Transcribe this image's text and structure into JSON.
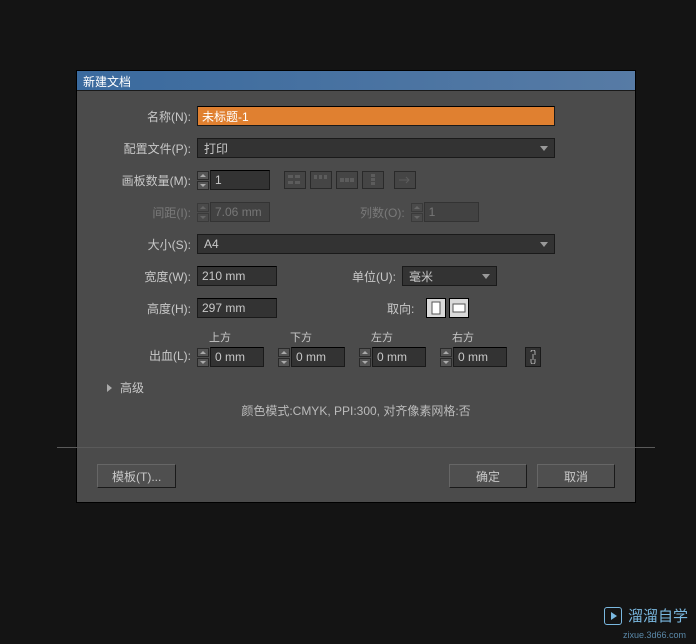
{
  "dialog": {
    "title": "新建文档",
    "name": {
      "label": "名称(N):",
      "value": "未标题-1"
    },
    "profile": {
      "label": "配置文件(P):",
      "value": "打印"
    },
    "artboards": {
      "label": "画板数量(M):",
      "value": "1"
    },
    "spacing": {
      "label": "间距(I):",
      "value": "7.06 mm"
    },
    "columns": {
      "label": "列数(O):",
      "value": "1"
    },
    "size": {
      "label": "大小(S):",
      "value": "A4"
    },
    "width": {
      "label": "宽度(W):",
      "value": "210 mm"
    },
    "height": {
      "label": "高度(H):",
      "value": "297 mm"
    },
    "units": {
      "label": "单位(U):",
      "value": "毫米"
    },
    "orientation": {
      "label": "取向:"
    },
    "bleed": {
      "label": "出血(L):",
      "top_label": "上方",
      "bottom_label": "下方",
      "left_label": "左方",
      "right_label": "右方",
      "top": "0 mm",
      "bottom": "0 mm",
      "left": "0 mm",
      "right": "0 mm"
    },
    "advanced": {
      "label": "高级"
    },
    "info": "颜色模式:CMYK, PPI:300, 对齐像素网格:否",
    "buttons": {
      "templates": "模板(T)...",
      "ok": "确定",
      "cancel": "取消"
    }
  },
  "watermark": {
    "text": "溜溜自学",
    "url": "zixue.3d66.com"
  }
}
